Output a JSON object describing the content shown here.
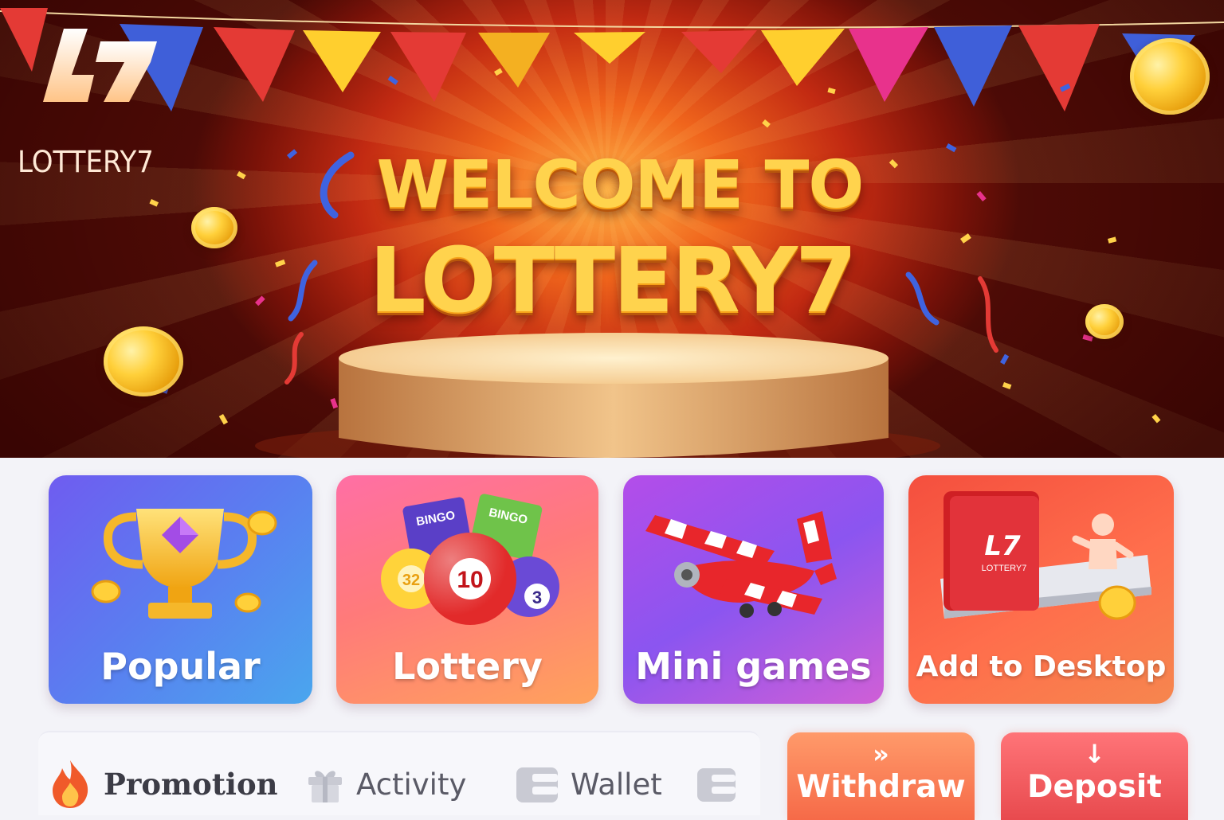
{
  "brand": {
    "mark_text": "L7",
    "name": "LOTTERY7"
  },
  "hero": {
    "title_line1": "WELCOME TO",
    "title_line2": "LOTTERY7"
  },
  "categories": [
    {
      "label": "Popular",
      "icon": "trophy-icon"
    },
    {
      "label": "Lottery",
      "icon": "lottery-balls-icon",
      "art_text": [
        "BINGO",
        "BINGO",
        "32",
        "10",
        "3"
      ]
    },
    {
      "label": "Mini games",
      "icon": "airplane-icon"
    },
    {
      "label": "Add to Desktop",
      "icon": "desktop-install-icon",
      "art_text": [
        "L7",
        "LOTTERY7"
      ]
    }
  ],
  "nav": {
    "items": [
      {
        "label": "Promotion",
        "icon": "fire-icon"
      },
      {
        "label": "Activity",
        "icon": "gift-icon"
      },
      {
        "label": "Wallet",
        "icon": "wallet-icon"
      },
      {
        "label": "",
        "icon": "wallet-icon"
      }
    ]
  },
  "actions": {
    "withdraw": {
      "label": "Withdraw",
      "icon": "double-chevron-right-icon",
      "glyph": "»"
    },
    "deposit": {
      "label": "Deposit",
      "icon": "arrow-down-icon",
      "glyph": "↓"
    }
  },
  "colors": {
    "hero_gold": "#ffd34d",
    "hero_red": "#c22a12",
    "popular": "#5a7ef0",
    "lottery": "#ff7a7a",
    "mini_games": "#8b55f0",
    "desktop": "#ff6e4c",
    "withdraw": "#f66a48",
    "deposit": "#e84a4e"
  }
}
